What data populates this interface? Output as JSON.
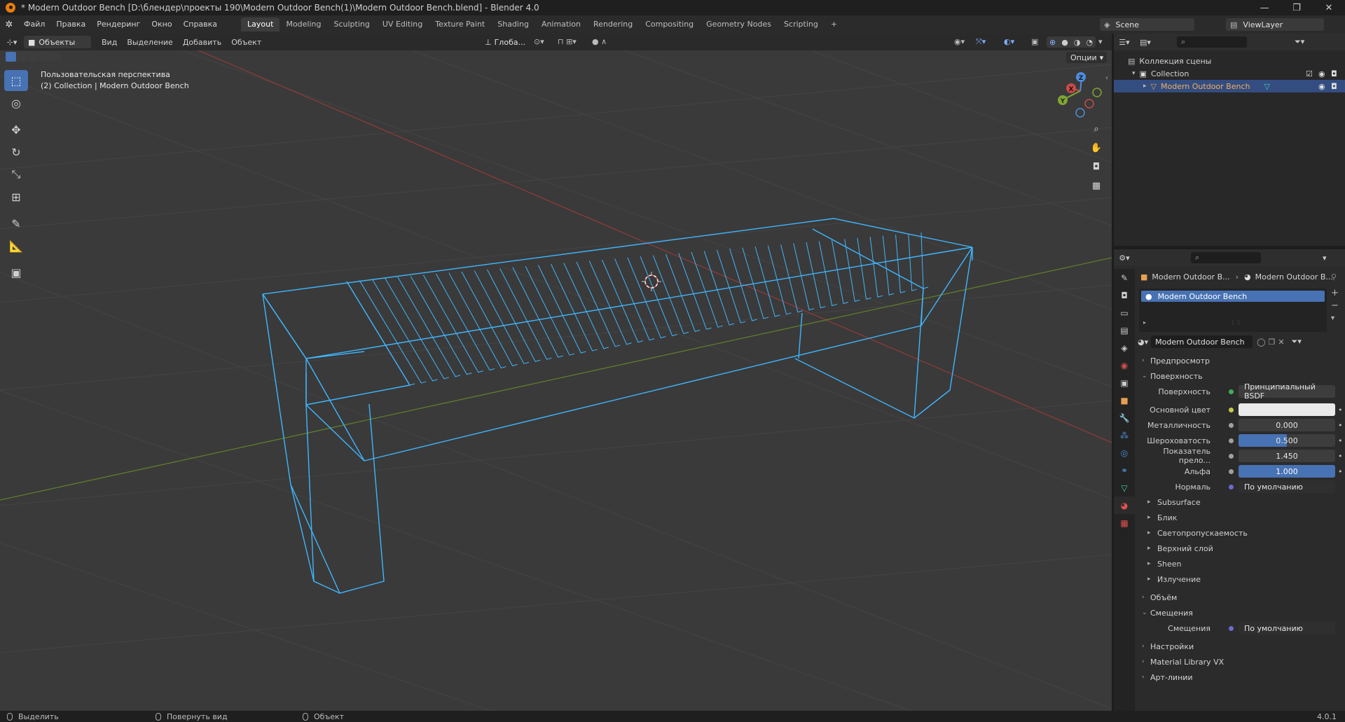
{
  "window": {
    "title": "* Modern Outdoor Bench [D:\\блендер\\проекты 190\\Modern Outdoor Bench(1)\\Modern Outdoor Bench.blend] - Blender 4.0",
    "minimize": "—",
    "maximize": "❐",
    "close": "✕"
  },
  "menu": {
    "items": [
      "Файл",
      "Правка",
      "Рендеринг",
      "Окно",
      "Справка"
    ]
  },
  "workspaces": [
    "Layout",
    "Modeling",
    "Sculpting",
    "UV Editing",
    "Texture Paint",
    "Shading",
    "Animation",
    "Rendering",
    "Compositing",
    "Geometry Nodes",
    "Scripting"
  ],
  "workspace_add": "+",
  "scene": {
    "name": "Scene",
    "view_layer": "ViewLayer"
  },
  "viewport": {
    "mode": "Объекты",
    "menus": [
      "Вид",
      "Выделение",
      "Добавить",
      "Объект"
    ],
    "orientation": "Глоба...",
    "options_label": "Опции",
    "info_line1": "Пользовательская перспектива",
    "info_line2": "(2) Collection | Modern Outdoor Bench",
    "gizmo": {
      "x": "X",
      "y": "Y",
      "z": "Z"
    }
  },
  "outliner": {
    "root": "Коллекция сцены",
    "collection": "Collection",
    "object": "Modern Outdoor Bench"
  },
  "properties": {
    "breadcrumb_object": "Modern Outdoor B...",
    "breadcrumb_material": "Modern Outdoor B...",
    "slot_name": "Modern Outdoor Bench",
    "material_name": "Modern Outdoor Bench",
    "sections": {
      "preview": "Предпросмотр",
      "surface": "Поверхность",
      "volume": "Объём",
      "displacement": "Смещения",
      "settings": "Настройки",
      "material_library": "Material Library VX",
      "lineart": "Арт-линии"
    },
    "surface_rows": [
      {
        "label": "Поверхность",
        "value": "Принципиальный BSDF",
        "dot": "#3fae5b",
        "style": "left"
      },
      {
        "label": "Основной цвет",
        "value": "",
        "dot": "#c8c84a",
        "style": "white"
      },
      {
        "label": "Металличность",
        "value": "0.000",
        "dot": "#a0a0a0",
        "style": "gray"
      },
      {
        "label": "Шероховатость",
        "value": "0.500",
        "dot": "#a0a0a0",
        "style": "blue"
      },
      {
        "label": "Показатель прело...",
        "value": "1.450",
        "dot": "#a0a0a0",
        "style": "gray"
      },
      {
        "label": "Альфа",
        "value": "1.000",
        "dot": "#a0a0a0",
        "style": "blue"
      },
      {
        "label": "Нормаль",
        "value": "По умолчанию",
        "dot": "#6a6ad0",
        "style": "left"
      }
    ],
    "subpanels": [
      "Subsurface",
      "Блик",
      "Светопропускаемость",
      "Верхний слой",
      "Sheen",
      "Излучение"
    ],
    "displacement_row": {
      "label": "Смещения",
      "value": "По умолчанию"
    }
  },
  "status": {
    "select": "Выделить",
    "rotate": "Повернуть вид",
    "object": "Объект",
    "version": "4.0.1"
  },
  "colors": {
    "accent": "#4772b3",
    "wire": "#3fb6ff",
    "axis_x": "#c84b4b",
    "axis_y": "#7fa535"
  }
}
